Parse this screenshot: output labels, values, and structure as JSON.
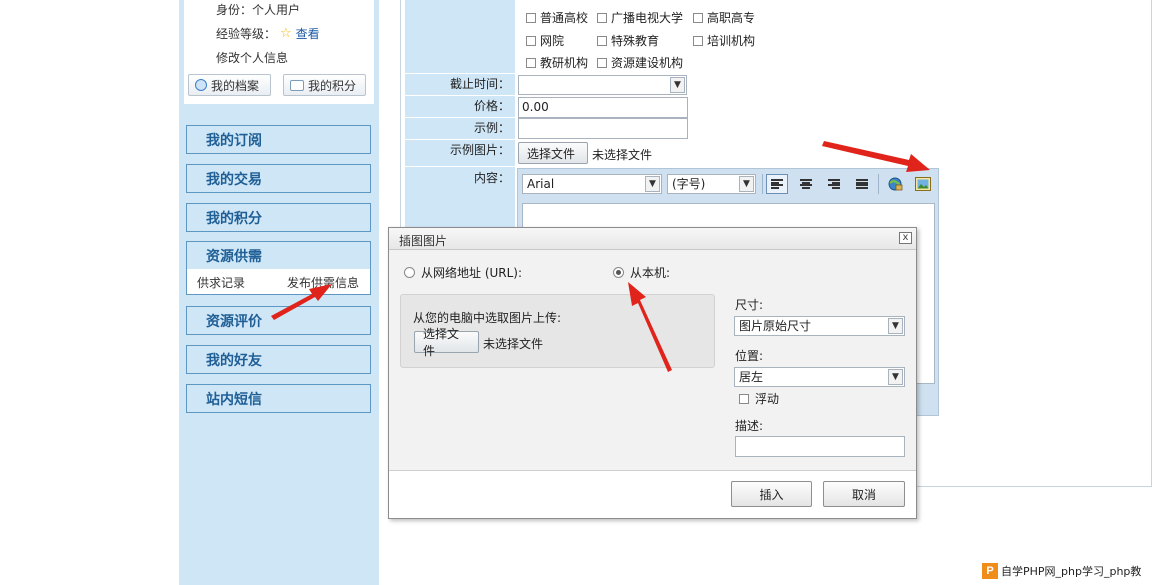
{
  "profile": {
    "identity_label": "身份：",
    "identity_value": "个人用户",
    "level_label": "经验等级：",
    "view_link": "查看",
    "edit_info": "修改个人信息",
    "btn_archive": "我的档案",
    "btn_points": "我的积分"
  },
  "nav": {
    "items": [
      "我的订阅",
      "我的交易",
      "我的积分",
      "资源供需",
      "资源评价",
      "我的好友",
      "站内短信"
    ],
    "submenu": [
      "供求记录",
      "发布供需信息"
    ]
  },
  "form": {
    "checkboxes": [
      "普通高校",
      "广播电视大学",
      "高职高专",
      "网院",
      "特殊教育",
      "培训机构",
      "教研机构",
      "资源建设机构"
    ],
    "deadline_label": "截止时间：",
    "price_label": "价格：",
    "price_value": "0.00",
    "example_label": "示例：",
    "example_image_label": "示例图片：",
    "choose_file": "选择文件",
    "no_file": "未选择文件",
    "content_label": "内容："
  },
  "editor": {
    "font_value": "Arial",
    "size_value": "(字号)"
  },
  "dialog": {
    "title": "插图图片",
    "close": "x",
    "option_url": "从网络地址 (URL):",
    "option_local": "从本机:",
    "upload_prompt": "从您的电脑中选取图片上传:",
    "choose_file": "选择文件",
    "no_file": "未选择文件",
    "size_label": "尺寸:",
    "size_value": "图片原始尺寸",
    "position_label": "位置:",
    "position_value": "居左",
    "float_label": "浮动",
    "desc_label": "描述:",
    "insert_btn": "插入",
    "cancel_btn": "取消"
  },
  "watermark": {
    "logo": "P",
    "text": "自学PHP网_php学习_php教"
  },
  "colors": {
    "sidebar_bg": "#cfe6f7",
    "nav_text": "#1f5f95",
    "arrow_red": "#e0241b"
  }
}
